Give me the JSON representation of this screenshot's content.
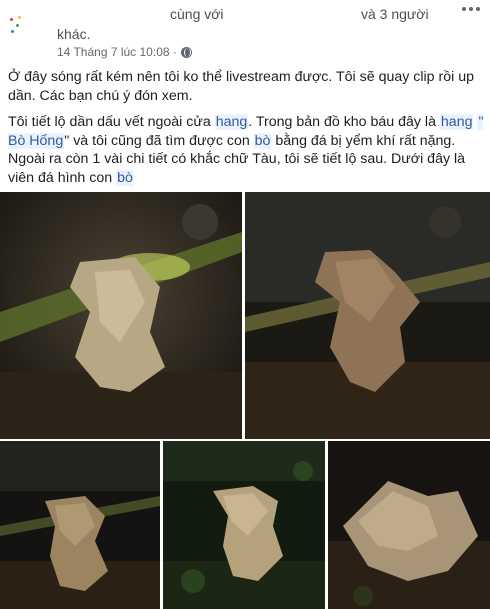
{
  "post": {
    "with_text": "cùng với",
    "others_link": "và 3 người",
    "line2_suffix": "khác.",
    "timestamp": "14 Tháng 7 lúc 10:08 ·",
    "privacy_icon": "globe-icon",
    "more_icon": "more-options-icon"
  },
  "body": {
    "p1": "Ở đây sóng rất kém nên tôi ko thể livestream được. Tôi sẽ quay clip rồi up dần. Các bạn chú ý đón xem.",
    "p2_a": "Tôi tiết lộ dần dấu vết ngoài cửa ",
    "p2_hl1": "hang",
    "p2_b": ". Trong bản đồ kho báu đây là ",
    "p2_hl2": "hang",
    "p2_c": " ",
    "p2_hl3": "\" Bò Hống",
    "p2_d": "\" và tôi cũng đã tìm được con ",
    "p2_hl4": "bò",
    "p2_e": " bằng đá bị yểm khí rất nặng. Ngoài ra còn 1 vài chi tiết có khắc chữ Tàu, tôi sẽ tiết lộ sau. Dưới đây là viên đá hình con ",
    "p2_hl5": "bò"
  },
  "photos": [
    {
      "name": "photo-1"
    },
    {
      "name": "photo-2"
    },
    {
      "name": "photo-3"
    },
    {
      "name": "photo-4"
    },
    {
      "name": "photo-5"
    }
  ],
  "colors": {
    "link": "#385898",
    "highlight_bg": "#e7f3ff",
    "meta_text": "#616770"
  }
}
